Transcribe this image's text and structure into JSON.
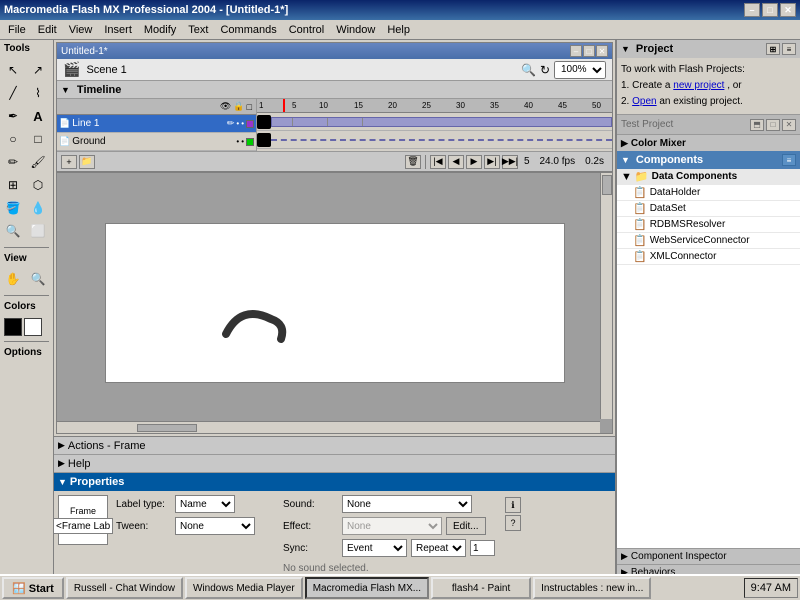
{
  "titleBar": {
    "title": "Macromedia Flash MX Professional 2004 - [Untitled-1*]",
    "minimize": "–",
    "maximize": "□",
    "close": "✕"
  },
  "menuBar": {
    "items": [
      "File",
      "Edit",
      "View",
      "Insert",
      "Modify",
      "Text",
      "Commands",
      "Control",
      "Window",
      "Help"
    ]
  },
  "docWindow": {
    "title": "Untitled-1*",
    "minimize": "–",
    "restore": "□",
    "close": "✕"
  },
  "scene": {
    "label": "Scene 1",
    "zoom": "100%"
  },
  "timeline": {
    "label": "Timeline",
    "layers": [
      {
        "name": "Line 1",
        "selected": true
      },
      {
        "name": "Ground",
        "selected": false
      }
    ],
    "frameInfo": {
      "frame": "5",
      "fps": "24.0 fps",
      "time": "0.2s"
    }
  },
  "tools": {
    "label": "Tools",
    "items": [
      "↖",
      "✏",
      "A",
      "◻",
      "○",
      "✂",
      "🪣",
      "💧",
      "🔍",
      "✋",
      "⬛",
      "⬜",
      "📌",
      "🎨"
    ],
    "viewLabel": "View",
    "colorsLabel": "Colors",
    "optionsLabel": "Options"
  },
  "bottomPanels": {
    "actionsLabel": "Actions - Frame",
    "helpLabel": "Help",
    "propertiesLabel": "Properties",
    "frameLabel": "Frame",
    "frameLabelInput": "<Frame Label>",
    "labelTypeLabel": "Label type:",
    "labelTypeValue": "Name",
    "tweenLabel": "Tween:",
    "tweenValue": "None",
    "soundLabel": "Sound:",
    "soundValue": "None",
    "effectLabel": "Effect:",
    "effectValue": "None",
    "editBtn": "Edit...",
    "syncLabel": "Sync:",
    "syncValue": "Event",
    "repeatValue": "Repeat",
    "repeatNum": "1",
    "noSoundText": "No sound selected."
  },
  "rightPanel": {
    "projectLabel": "Project",
    "projectText1": "To work with Flash Projects:",
    "projectText2": "1. Create a ",
    "projectLink1": "new project",
    "projectText3": ", or",
    "projectText4": "2. ",
    "projectLink2": "Open",
    "projectText5": " an existing project.",
    "testProjectLabel": "Test Project",
    "colorMixerLabel": "Color Mixer",
    "componentsLabel": "Components",
    "componentTree": [
      {
        "level": 0,
        "name": "Data Components",
        "icon": "📁",
        "isParent": true
      },
      {
        "level": 1,
        "name": "DataHolder",
        "icon": "📋"
      },
      {
        "level": 1,
        "name": "DataSet",
        "icon": "📋"
      },
      {
        "level": 1,
        "name": "RDBMSResolver",
        "icon": "📋"
      },
      {
        "level": 1,
        "name": "WebServiceConnector",
        "icon": "📋"
      },
      {
        "level": 1,
        "name": "XMLConnector",
        "icon": "📋"
      }
    ],
    "componentInspectorLabel": "Component Inspector",
    "behaviorsLabel": "Behaviors"
  },
  "taskbar": {
    "startLabel": "Start",
    "tasks": [
      {
        "label": "Russell - Chat Window",
        "active": false
      },
      {
        "label": "Windows Media Player",
        "active": false
      },
      {
        "label": "Macromedia Flash MX...",
        "active": true
      },
      {
        "label": "flash4 - Paint",
        "active": false
      },
      {
        "label": "Instructables : new in...",
        "active": false
      }
    ],
    "clock": "9:47 AM"
  }
}
